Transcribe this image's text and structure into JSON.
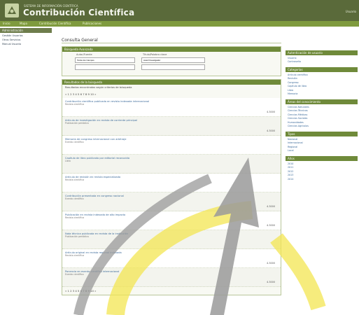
{
  "header": {
    "supra": "SISTEMA DE INFORMACIÓN CIENTÍFICA",
    "title": "Contribución Científica",
    "right_label": "Usuario"
  },
  "nav": {
    "items": [
      "Inicio",
      "Mapa",
      "Contribución Científica",
      "Publicaciones"
    ]
  },
  "sidebar": {
    "header": "Administración",
    "links": [
      "Gestión Usuarios",
      "Otros Servicios",
      "Manual Usuario"
    ]
  },
  "main": {
    "page_title": "Consulta General",
    "search_panel_title": "Búsqueda Avanzada",
    "search_labels": [
      "Autor/Fuente",
      "Título/Palabra clave"
    ],
    "search_value_a": "Todos los Campos",
    "search_value_b": "Autor/Investigador",
    "results_panel_title": "Resultados de la búsqueda",
    "results_info": "Resultados encontrados según criterios de búsqueda",
    "buscar_label": "Buscar",
    "results": [
      {
        "title": "Contribución científica publicada en revista indexada internacional",
        "meta": "Revista científica",
        "points": "4.3000"
      },
      {
        "title": "Artículo de investigación en revista de corriente principal",
        "meta": "Publicación periódica",
        "points": "4.3000"
      },
      {
        "title": "Memoria de congreso internacional con arbitraje",
        "meta": "Evento científico",
        "points": ""
      },
      {
        "title": "Capítulo de libro publicado por editorial reconocida",
        "meta": "Libro",
        "points": ""
      },
      {
        "title": "Artículo de revisión en revista especializada",
        "meta": "Revista científica",
        "points": ""
      },
      {
        "title": "Contribución presentada en congreso nacional",
        "meta": "Evento científico",
        "points": "4.3000"
      },
      {
        "title": "Publicación en revista indexada de alto impacto",
        "meta": "Revista científica",
        "points": "4.3000"
      },
      {
        "title": "Nota técnica publicada en revista de la institución",
        "meta": "Publicación periódica",
        "points": ""
      },
      {
        "title": "Artículo original en revista regional indexada",
        "meta": "Revista científica",
        "points": "4.3000"
      },
      {
        "title": "Ponencia en evento científico internacional",
        "meta": "Evento científico",
        "points": "4.3000"
      }
    ],
    "pagination": "« 1 2 3 4 5 6 7 8 9 10 »"
  },
  "right": {
    "sections": [
      {
        "title": "Autenticación de usuario",
        "items": [
          "Usuario",
          "Contraseña"
        ]
      },
      {
        "title": "Categorías",
        "items": [
          "Artículo científico",
          "Revisión",
          "Congreso",
          "Capítulo de libro",
          "Libro",
          "Memoria"
        ]
      },
      {
        "title": "Áreas del conocimiento",
        "items": [
          "Ciencias Naturales",
          "Ciencias Técnicas",
          "Ciencias Médicas",
          "Ciencias Sociales",
          "Humanidades",
          "Ciencias Agrícolas"
        ]
      },
      {
        "title": "Tipos",
        "items": [
          "Nacional",
          "Internacional",
          "Regional",
          "Local"
        ]
      },
      {
        "title": "Años",
        "items": [
          "2010",
          "2011",
          "2012",
          "2013",
          "2014"
        ]
      }
    ]
  }
}
